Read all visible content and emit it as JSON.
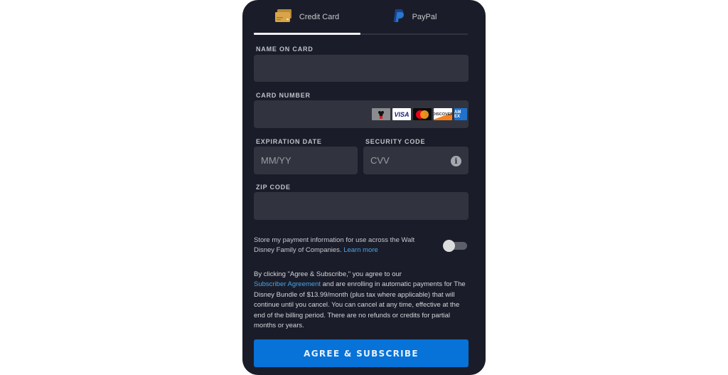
{
  "tabs": [
    {
      "label": "Credit Card",
      "icon": "credit-card-icon",
      "active": true
    },
    {
      "label": "PayPal",
      "icon": "paypal-icon",
      "active": false
    }
  ],
  "form": {
    "name_on_card": {
      "label": "NAME ON CARD",
      "value": "",
      "placeholder": ""
    },
    "card_number": {
      "label": "CARD NUMBER",
      "value": "",
      "placeholder": ""
    },
    "expiration_date": {
      "label": "EXPIRATION DATE",
      "value": "",
      "placeholder": "MM/YY"
    },
    "security_code": {
      "label": "SECURITY CODE",
      "value": "",
      "placeholder": "CVV",
      "info_icon": "info-icon"
    },
    "zip_code": {
      "label": "ZIP CODE",
      "value": "",
      "placeholder": ""
    }
  },
  "card_brands": [
    {
      "name": "Disney Visa",
      "icon": "disney-card-icon"
    },
    {
      "name": "VISA",
      "icon": "visa-icon"
    },
    {
      "name": "Mastercard",
      "icon": "mastercard-icon"
    },
    {
      "name": "DISCOVER",
      "icon": "discover-icon"
    },
    {
      "name": "AMEX",
      "icon": "amex-icon"
    }
  ],
  "store_payment": {
    "text": "Store my payment information for use across the Walt Disney Family of Companies.",
    "link": "Learn more",
    "enabled": false
  },
  "legal": {
    "prefix": "By clicking \"Agree & Subscribe,\" you agree to our",
    "link": "Subscriber Agreement",
    "suffix": "and are enrolling in automatic payments for The Disney Bundle of $13.99/month (plus tax where applicable) that will continue until you cancel. You can cancel at any time, effective at the end of the billing period. There are no refunds or credits for partial months or years."
  },
  "submit_label": "AGREE & SUBSCRIBE",
  "colors": {
    "panel_bg": "#1a1d29",
    "input_bg": "#31343e",
    "accent": "#0772d7",
    "link": "#4aa3e8"
  }
}
